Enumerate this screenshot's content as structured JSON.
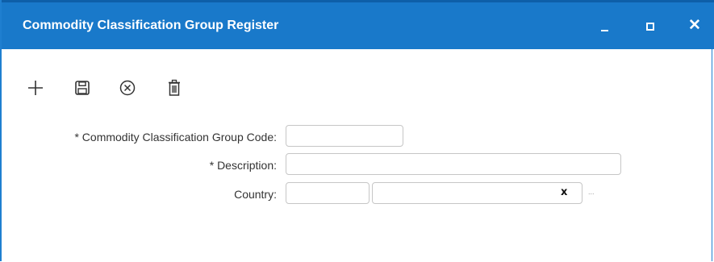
{
  "window": {
    "title": "Commodity Classification Group Register",
    "controls": {
      "minimize": "_",
      "maximize": "□",
      "close": "✕"
    },
    "accent_color": "#1979ca"
  },
  "toolbar": {
    "icons": [
      "add-icon",
      "save-icon",
      "cancel-icon",
      "delete-icon"
    ]
  },
  "form": {
    "code_label": "* Commodity Classification Group Code:",
    "code_value": "",
    "description_label": "* Description:",
    "description_value": "",
    "country_label": "Country:",
    "country_code_value": "",
    "country_name_value": "",
    "clear_label": "x",
    "lookup_label": "..."
  }
}
